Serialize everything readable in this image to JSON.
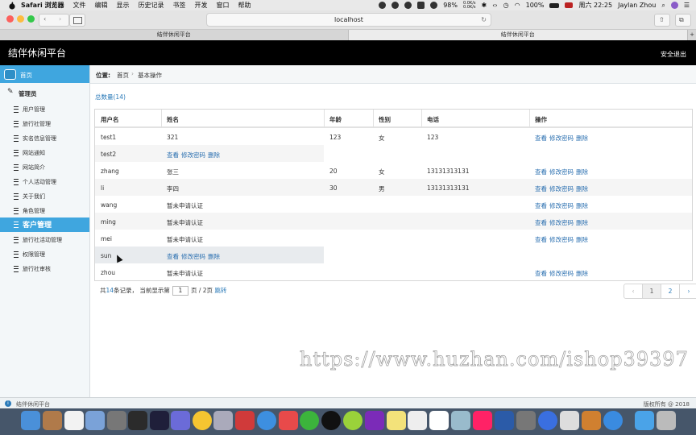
{
  "menubar": {
    "items": [
      "Safari 浏览器",
      "文件",
      "编辑",
      "显示",
      "历史记录",
      "书签",
      "开发",
      "窗口",
      "帮助"
    ],
    "battery": "98%",
    "net_up": "0.0K/s",
    "net_down": "0.0K/s",
    "battery2": "100%",
    "clock": "周六 22:25",
    "user": "Jaylan Zhou"
  },
  "browser": {
    "url": "localhost",
    "tabs": [
      "结伴休闲平台",
      "结伴休闲平台"
    ],
    "new_tab": "+"
  },
  "app": {
    "title": "结伴休闲平台",
    "logout": "安全退出"
  },
  "sidebar": {
    "home": "首页",
    "admin": "管理员",
    "items": [
      "用户管理",
      "旅行社管理",
      "实名信息管理",
      "网站通知",
      "网站简介",
      "个人活动管理",
      "关于我们",
      "角色管理",
      "客户管理",
      "旅行社活动管理",
      "权限管理",
      "旅行社审核"
    ],
    "active_index": 8
  },
  "breadcrumb": {
    "label": "位置:",
    "home": "首页",
    "separator": "›",
    "current": "基本操作"
  },
  "total": "总数量(14)",
  "table": {
    "headers": [
      "用户名",
      "姓名",
      "年龄",
      "性别",
      "电话",
      "操作"
    ],
    "action_labels": [
      "查看",
      "修改密码",
      "删除"
    ],
    "rows": [
      {
        "username": "test1",
        "name": "321",
        "age": "123",
        "gender": "女",
        "phone": "123",
        "action_in_name_col": false
      },
      {
        "username": "test2",
        "name": "",
        "age": "",
        "gender": "",
        "phone": "",
        "action_in_name_col": true
      },
      {
        "username": "zhang",
        "name": "张三",
        "age": "20",
        "gender": "女",
        "phone": "13131313131",
        "action_in_name_col": false
      },
      {
        "username": "li",
        "name": "李四",
        "age": "30",
        "gender": "男",
        "phone": "13131313131",
        "action_in_name_col": false
      },
      {
        "username": "wang",
        "name": "暂未申请认证",
        "age": "",
        "gender": "",
        "phone": "",
        "action_in_name_col": false
      },
      {
        "username": "ming",
        "name": "暂未申请认证",
        "age": "",
        "gender": "",
        "phone": "",
        "action_in_name_col": false
      },
      {
        "username": "mei",
        "name": "暂未申请认证",
        "age": "",
        "gender": "",
        "phone": "",
        "action_in_name_col": false
      },
      {
        "username": "sun",
        "name": "",
        "age": "",
        "gender": "",
        "phone": "",
        "action_in_name_col": true
      },
      {
        "username": "zhou",
        "name": "暂未申请认证",
        "age": "",
        "gender": "",
        "phone": "",
        "action_in_name_col": false
      }
    ]
  },
  "pagination": {
    "prefix": "共",
    "count": "14",
    "mid": "条记录， 当前显示第",
    "page_value": "1",
    "suffix": "页 / 2页",
    "jump": "跳转",
    "prev": "‹",
    "pages": [
      "1",
      "2"
    ],
    "next": "›"
  },
  "watermark": "https://www.huzhan.com/ishop39397",
  "footer": {
    "brand": "结伴休闲平台",
    "copyright": "版权所有 @ 2018"
  },
  "colors": {
    "accent": "#3fa6df",
    "link": "#2a6fb0",
    "header_bg": "#000000"
  }
}
